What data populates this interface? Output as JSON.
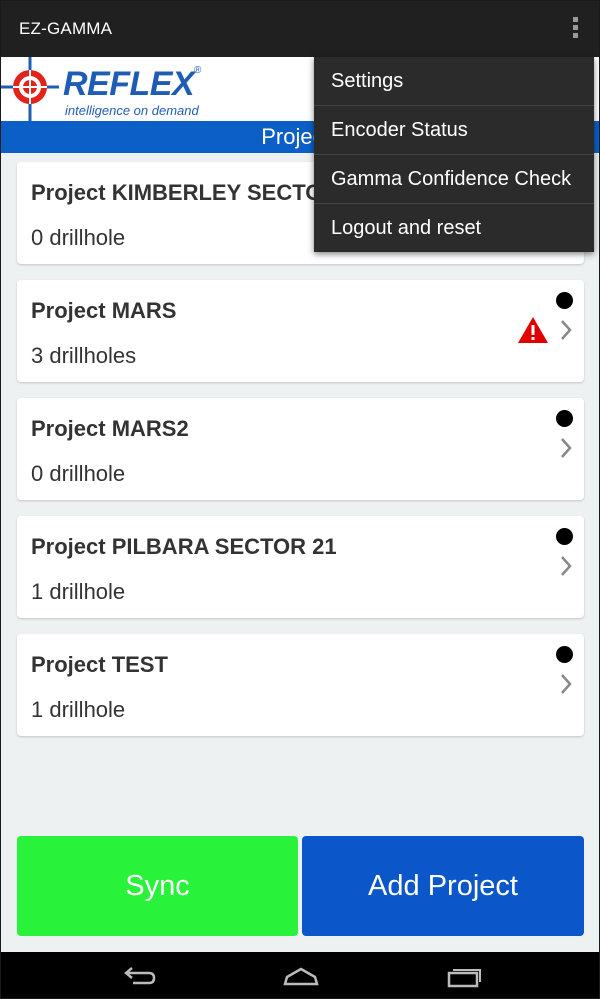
{
  "app": {
    "title": "EZ-GAMMA"
  },
  "branding": {
    "logo_text": "REFLEX",
    "logo_reg": "®",
    "tagline": "intelligence on demand"
  },
  "section": {
    "title": "Projects"
  },
  "projects": [
    {
      "name": "Project KIMBERLEY SECTOR",
      "count": "0 drillhole",
      "status_dot": false,
      "warning": false
    },
    {
      "name": "Project MARS",
      "count": "3 drillholes",
      "status_dot": true,
      "warning": true
    },
    {
      "name": "Project MARS2",
      "count": "0 drillhole",
      "status_dot": true,
      "warning": false
    },
    {
      "name": "Project PILBARA SECTOR 21",
      "count": "1 drillhole",
      "status_dot": true,
      "warning": false
    },
    {
      "name": "Project TEST",
      "count": "1 drillhole",
      "status_dot": true,
      "warning": false
    }
  ],
  "menu": {
    "items": [
      "Settings",
      "Encoder Status",
      "Gamma Confidence Check",
      "Logout and reset"
    ]
  },
  "buttons": {
    "sync": "Sync",
    "add_project": "Add Project"
  },
  "colors": {
    "sync": "#28f23a",
    "add_project": "#0b57c9",
    "section_bar": "#0b5fc6",
    "warning": "#e00000",
    "brand": "#1f5db5"
  },
  "icons": [
    "overflow-menu-icon",
    "reflex-logo-icon",
    "chevron-right-icon",
    "warning-icon",
    "status-dot-icon",
    "back-icon",
    "home-icon",
    "recents-icon"
  ]
}
